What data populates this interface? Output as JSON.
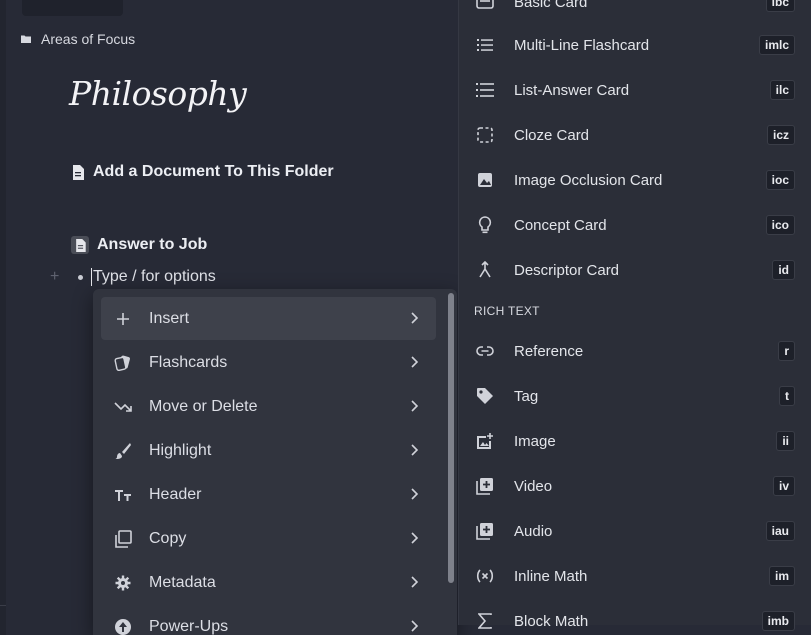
{
  "breadcrumb": {
    "label": "Areas of Focus",
    "icon": "folder-icon"
  },
  "page": {
    "title": "Philosophy",
    "rows": [
      {
        "label": "Add a Document To This Folder",
        "icon": "document-icon"
      },
      {
        "label": "Answer to Job",
        "icon": "document-icon"
      }
    ],
    "bullet_placeholder": "Type / for options"
  },
  "context_menu": {
    "items": [
      {
        "label": "Insert",
        "icon": "plus-icon",
        "highlighted": true
      },
      {
        "label": "Flashcards",
        "icon": "cards-icon"
      },
      {
        "label": "Move or Delete",
        "icon": "move-arrow-icon"
      },
      {
        "label": "Highlight",
        "icon": "brush-icon"
      },
      {
        "label": "Header",
        "icon": "text-size-icon"
      },
      {
        "label": "Copy",
        "icon": "copy-icon"
      },
      {
        "label": "Metadata",
        "icon": "gear-icon"
      },
      {
        "label": "Power-Ups",
        "icon": "power-up-icon"
      }
    ]
  },
  "slash_menu": {
    "items": [
      {
        "label": "Basic Card",
        "shortcut": "ibc",
        "icon": "basic-card-icon"
      },
      {
        "label": "Multi-Line Flashcard",
        "shortcut": "imlc",
        "icon": "multiline-list-icon"
      },
      {
        "label": "List-Answer Card",
        "shortcut": "ilc",
        "icon": "list-icon"
      },
      {
        "label": "Cloze Card",
        "shortcut": "icz",
        "icon": "dashed-square-icon"
      },
      {
        "label": "Image Occlusion Card",
        "shortcut": "ioc",
        "icon": "image-occlusion-icon"
      },
      {
        "label": "Concept Card",
        "shortcut": "ico",
        "icon": "lightbulb-icon"
      },
      {
        "label": "Descriptor Card",
        "shortcut": "id",
        "icon": "fork-icon"
      }
    ],
    "section_label": "RICH TEXT",
    "rich_items": [
      {
        "label": "Reference",
        "shortcut": "r",
        "icon": "link-icon"
      },
      {
        "label": "Tag",
        "shortcut": "t",
        "icon": "tag-icon"
      },
      {
        "label": "Image",
        "shortcut": "ii",
        "icon": "add-image-icon"
      },
      {
        "label": "Video",
        "shortcut": "iv",
        "icon": "add-video-icon"
      },
      {
        "label": "Audio",
        "shortcut": "iau",
        "icon": "add-audio-icon"
      },
      {
        "label": "Inline Math",
        "shortcut": "im",
        "icon": "math-variable-icon"
      },
      {
        "label": "Block Math",
        "shortcut": "imb",
        "icon": "sigma-icon"
      }
    ]
  }
}
